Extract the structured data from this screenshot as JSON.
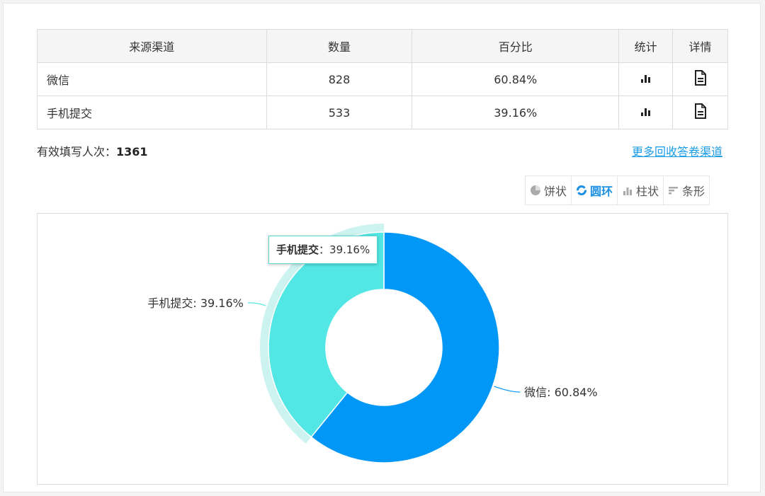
{
  "table": {
    "headers": [
      "来源渠道",
      "数量",
      "百分比",
      "统计",
      "详情"
    ],
    "rows": [
      {
        "channel": "微信",
        "count": "828",
        "percent": "60.84%"
      },
      {
        "channel": "手机提交",
        "count": "533",
        "percent": "39.16%"
      }
    ]
  },
  "summary": {
    "label": "有效填写人次：",
    "value": "1361"
  },
  "more_link": "更多回收答卷渠道",
  "chart_types": {
    "pie": "饼状",
    "ring": "圆环",
    "column": "柱状",
    "bar": "条形",
    "active": "ring"
  },
  "tooltip": {
    "name": "手机提交",
    "sep": "：",
    "value": "39.16%"
  },
  "chart_data": {
    "type": "pie",
    "variant": "donut",
    "series": [
      {
        "name": "微信",
        "value": 60.84,
        "label": "微信: 60.84%",
        "color": "#0197f6"
      },
      {
        "name": "手机提交",
        "value": 39.16,
        "label": "手机提交: 39.16%",
        "color": "#52e7e4",
        "highlighted": true
      }
    ]
  },
  "colors": {
    "accent": "#1a9de8",
    "wechat": "#0197f6",
    "mobile": "#52e7e4",
    "mobile_halo": "#cdf3f1"
  }
}
